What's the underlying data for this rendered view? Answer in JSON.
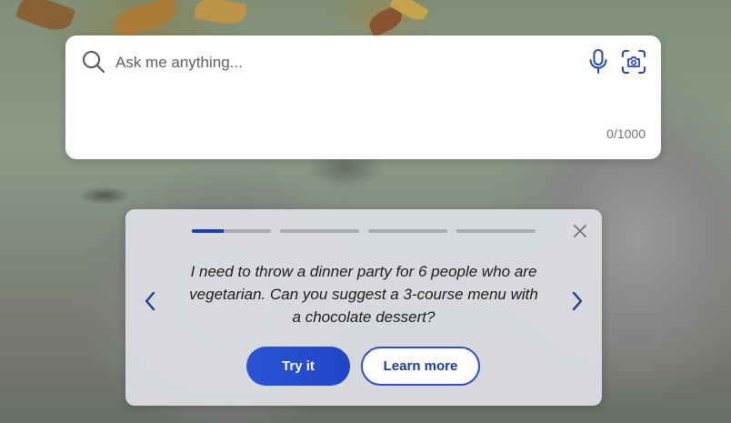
{
  "search": {
    "placeholder": "Ask me anything...",
    "value": "",
    "char_counter": "0/1000",
    "mic_icon": "microphone-icon",
    "camera_icon": "visual-search-icon",
    "search_icon": "magnifier-icon"
  },
  "suggestion": {
    "progress": {
      "total_steps": 4,
      "current_step": 1,
      "current_step_fill": 0.4
    },
    "text": "I need to throw a dinner party for 6 people who are vegetarian. Can you suggest a 3-course menu with a chocolate dessert?",
    "try_label": "Try it",
    "learn_label": "Learn more",
    "prev_icon": "chevron-left-icon",
    "next_icon": "chevron-right-icon",
    "close_icon": "close-icon"
  },
  "colors": {
    "accent": "#2a55d6",
    "progress_active": "#1b3fa8",
    "progress_inactive": "#a9abae"
  }
}
